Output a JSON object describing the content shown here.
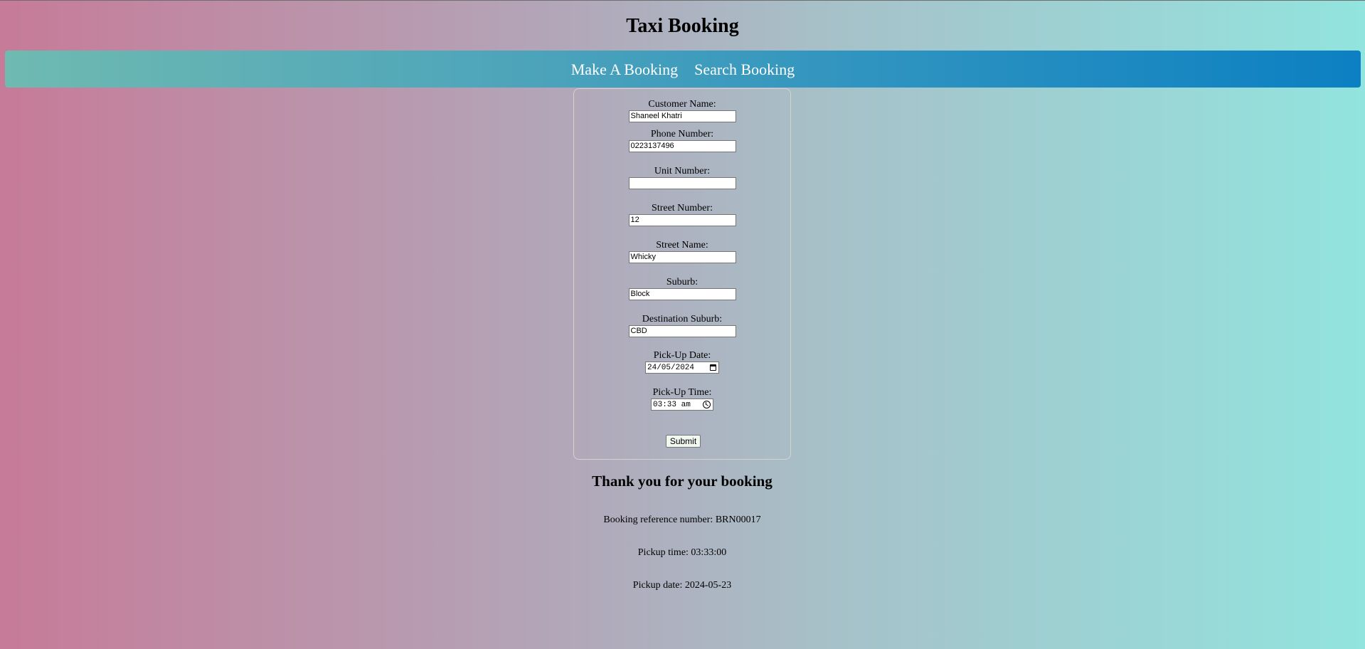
{
  "header": {
    "title": "Taxi Booking"
  },
  "nav": {
    "items": [
      {
        "label": "Make A Booking"
      },
      {
        "label": "Search Booking"
      }
    ],
    "gradient": [
      "#6fbab1",
      "#0c80c2"
    ]
  },
  "form": {
    "fields": [
      {
        "label": "Customer Name:",
        "value": "Shaneel Khatri"
      },
      {
        "label": "Phone Number:",
        "value": "0223137496"
      },
      {
        "label": "Unit Number:",
        "value": ""
      },
      {
        "label": "Street Number:",
        "value": "12"
      },
      {
        "label": "Street Name:",
        "value": "Whicky"
      },
      {
        "label": "Suburb:",
        "value": "Block"
      },
      {
        "label": "Destination Suburb:",
        "value": "CBD"
      }
    ],
    "pickup_date": {
      "label": "Pick-Up Date:",
      "value": "24/05/2024",
      "icon": "calendar-icon"
    },
    "pickup_time": {
      "label": "Pick-Up Time:",
      "value": "03:33 am",
      "icon": "clock-icon"
    },
    "submit_label": "Submit"
  },
  "confirmation": {
    "title": "Thank you for your booking",
    "reference": "Booking reference number: BRN00017",
    "pickup_time": "Pickup time: 03:33:00",
    "pickup_date": "Pickup date: 2024-05-23"
  },
  "colors": {
    "background_left": "#c67b98",
    "background_right": "#92e4de"
  }
}
